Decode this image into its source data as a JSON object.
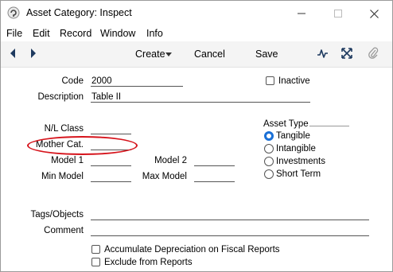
{
  "window": {
    "title": "Asset Category: Inspect",
    "minimize_icon": "minimize-icon",
    "maximize_icon": "maximize-icon",
    "close_icon": "close-icon"
  },
  "menu": [
    "File",
    "Edit",
    "Record",
    "Window",
    "Info"
  ],
  "toolbar": {
    "prev_icon": "chevron-left-icon",
    "next_icon": "chevron-right-icon",
    "create_label": "Create",
    "cancel_label": "Cancel",
    "save_label": "Save",
    "activity_icon": "activity-icon",
    "expand_icon": "expand-icon",
    "attach_icon": "paperclip-icon"
  },
  "form": {
    "code": {
      "label": "Code",
      "value": "2000"
    },
    "inactive": {
      "label": "Inactive",
      "checked": false
    },
    "description": {
      "label": "Description",
      "value": "Table II"
    },
    "nl_class": {
      "label": "N/L Class",
      "value": ""
    },
    "mother_cat": {
      "label": "Mother Cat.",
      "value": ""
    },
    "model1": {
      "label": "Model 1",
      "value": ""
    },
    "model2": {
      "label": "Model 2",
      "value": ""
    },
    "min_model": {
      "label": "Min Model",
      "value": ""
    },
    "max_model": {
      "label": "Max Model",
      "value": ""
    },
    "asset_type": {
      "label": "Asset Type",
      "options": [
        "Tangible",
        "Intangible",
        "Investments",
        "Short Term"
      ],
      "selected": "Tangible"
    },
    "tags": {
      "label": "Tags/Objects",
      "value": ""
    },
    "comment": {
      "label": "Comment",
      "value": ""
    },
    "accumulate_dep": {
      "label": "Accumulate Depreciation on Fiscal Reports",
      "checked": false
    },
    "exclude_reports": {
      "label": "Exclude from Reports",
      "checked": false
    }
  },
  "colors": {
    "highlight_oval": "#d6141c",
    "radio_selected": "#1a6fd6"
  }
}
